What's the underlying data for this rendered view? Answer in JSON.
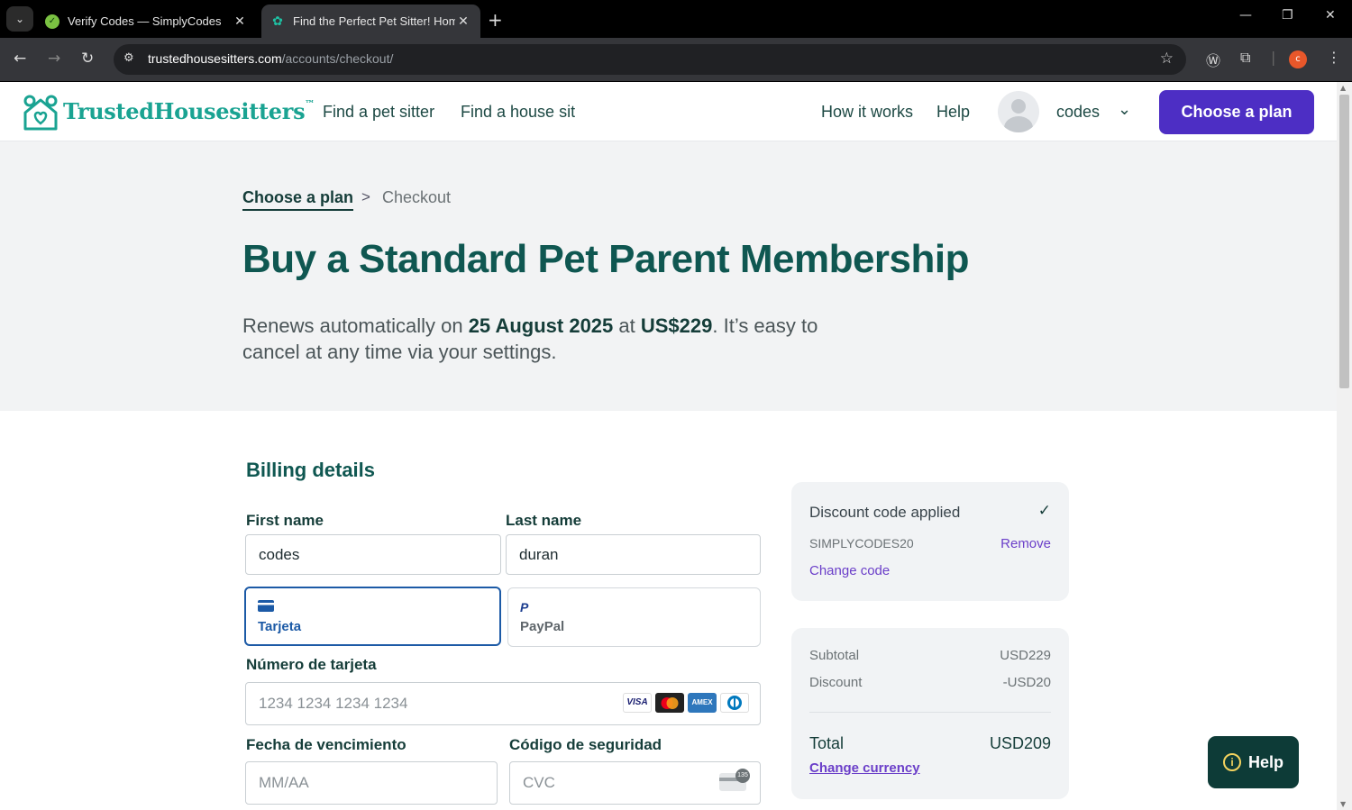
{
  "browser": {
    "tabs": [
      {
        "title": "Verify Codes — SimplyCodes",
        "active": false
      },
      {
        "title": "Find the Perfect Pet Sitter! Hom",
        "active": true
      }
    ],
    "url_domain": "trustedhousesitters.com",
    "url_path": "/accounts/checkout/",
    "profile_initial": "c"
  },
  "header": {
    "brand": "TrustedHousesitters",
    "brand_mark": "™",
    "nav_left": [
      "Find a pet sitter",
      "Find a house sit"
    ],
    "nav_right": [
      "How it works",
      "Help"
    ],
    "user_name": "codes",
    "cta_label": "Choose a plan"
  },
  "hero": {
    "breadcrumb": [
      "Choose a plan",
      "Checkout"
    ],
    "title": "Buy a Standard Pet Parent Membership",
    "renew_prefix": "Renews automatically on ",
    "renew_date": "25 August 2025",
    "renew_mid": " at ",
    "renew_price": "US$229",
    "renew_suffix": ". It’s easy to cancel at any time via your settings."
  },
  "billing": {
    "title": "Billing details",
    "first_name_label": "First name",
    "first_name_value": "codes",
    "last_name_label": "Last name",
    "last_name_value": "duran",
    "payment_methods": [
      {
        "label": "Tarjeta",
        "selected": true
      },
      {
        "label": "PayPal",
        "selected": false
      }
    ],
    "card_number_label": "Número de tarjeta",
    "card_number_placeholder": "1234 1234 1234 1234",
    "card_brands": [
      "VISA",
      "mastercard",
      "AMEX",
      "diners"
    ],
    "expiry_label": "Fecha de vencimiento",
    "expiry_placeholder": "MM/AA",
    "cvc_label": "Código de seguridad",
    "cvc_placeholder": "CVC",
    "cvc_badge": "135"
  },
  "discount": {
    "title": "Discount code applied",
    "code": "SIMPLYCODES20",
    "remove_label": "Remove",
    "change_label": "Change code"
  },
  "summary": {
    "subtotal_label": "Subtotal",
    "subtotal_value": "USD229",
    "discount_label": "Discount",
    "discount_value": "-USD20",
    "total_label": "Total",
    "total_value": "USD209",
    "change_currency_label": "Change currency"
  },
  "help_widget": {
    "label": "Help"
  },
  "colors": {
    "brand_teal": "#1aa392",
    "heading_green": "#0f5751",
    "cta_purple": "#4d2ec4",
    "link_purple": "#6b3fc9",
    "selected_blue": "#1c5aa6"
  }
}
